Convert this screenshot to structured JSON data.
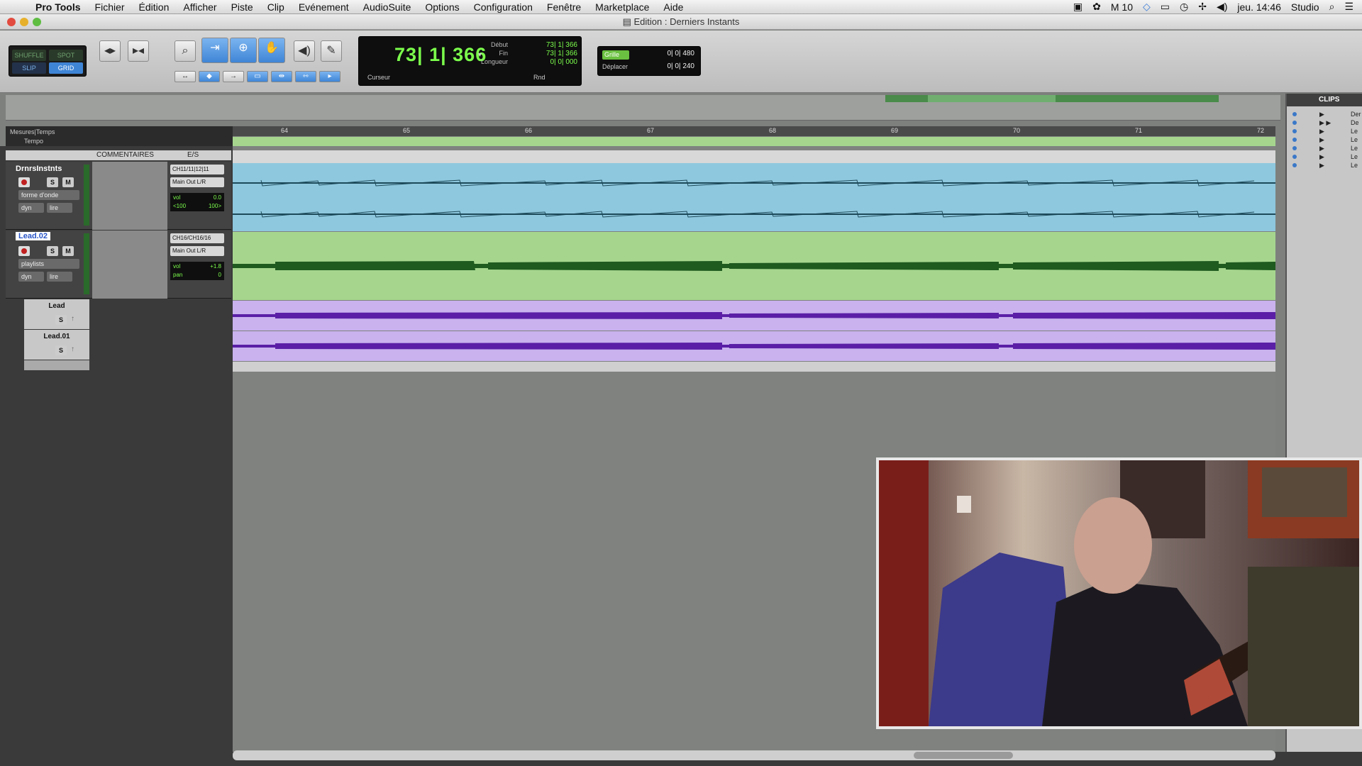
{
  "menubar": {
    "app": "Pro Tools",
    "items": [
      "Fichier",
      "Édition",
      "Afficher",
      "Piste",
      "Clip",
      "Evénement",
      "AudioSuite",
      "Options",
      "Configuration",
      "Fenêtre",
      "Marketplace",
      "Aide"
    ],
    "status_count": "10",
    "clock": "jeu. 14:46",
    "user": "Studio"
  },
  "window": {
    "title": "Edition : Derniers Instants"
  },
  "modes": {
    "shuffle": "SHUFFLE",
    "spot": "SPOT",
    "slip": "SLIP",
    "grid": "GRID"
  },
  "counter": {
    "main": "73| 1| 366",
    "start_label": "Début",
    "start_value": "73| 1| 366",
    "end_label": "Fin",
    "end_value": "73| 1| 366",
    "length_label": "Longueur",
    "length_value": "0| 0| 000",
    "cursor_label": "Curseur",
    "rnd_label": "Rnd"
  },
  "grid": {
    "grid_label": "Grille",
    "grid_value": "0| 0| 480",
    "nudge_label": "Déplacer",
    "nudge_value": "0| 0| 240"
  },
  "ruler": {
    "bars_label": "Mesures|Temps",
    "tempo_label": "Tempo",
    "bars": [
      "64",
      "65",
      "66",
      "67",
      "68",
      "69",
      "70",
      "71",
      "72"
    ]
  },
  "columns": {
    "comments": "COMMENTAIRES",
    "io": "E/S"
  },
  "tracks": [
    {
      "name": "DrnrsInstnts",
      "view": "forme d'onde",
      "dyn": "dyn",
      "auto": "lire",
      "input": "CH11/11|12|11",
      "output": "Main Out L/R",
      "vol_label": "vol",
      "vol_value": "0.0",
      "pan_left": "<100",
      "pan_right": "100>",
      "solo": "S",
      "mute": "M"
    },
    {
      "name": "Lead.02",
      "view": "playlists",
      "dyn": "dyn",
      "auto": "lire",
      "input": "CH16/CH16/16",
      "output": "Main Out L/R",
      "vol_label": "vol",
      "vol_value": "+1.8",
      "pan_label": "pan",
      "pan_value": "0",
      "solo": "S",
      "mute": "M"
    }
  ],
  "lanes": [
    {
      "name": "Lead",
      "solo": "S"
    },
    {
      "name": "Lead.01",
      "solo": "S"
    }
  ],
  "clips": {
    "header": "CLIPS",
    "rows": [
      {
        "t": "▶",
        "n": "Der"
      },
      {
        "t": "▶ ▶",
        "n": "De"
      },
      {
        "t": "▶",
        "n": "Le"
      },
      {
        "t": "▶",
        "n": "Le"
      },
      {
        "t": "▶",
        "n": "Le"
      },
      {
        "t": "▶",
        "n": "Le"
      },
      {
        "t": "▶",
        "n": "Le"
      }
    ]
  },
  "colors": {
    "stereo_clip": "#8ec8de",
    "stereo_wave": "#1d4a5a",
    "lead_clip": "#a6d68e",
    "lead_wave": "#1f5a1f",
    "playlist_clip": "#c9b2ee",
    "playlist_wave": "#5a1fa6"
  }
}
